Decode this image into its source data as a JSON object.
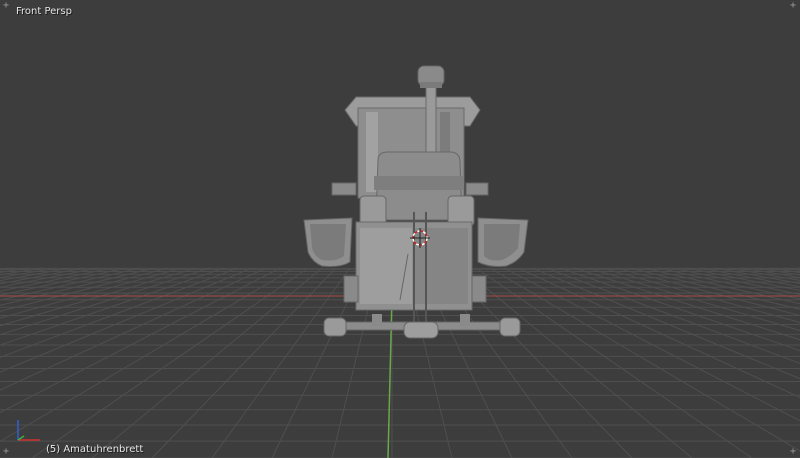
{
  "viewport": {
    "view_label": "Front Persp",
    "object_label": "(5) Amatuhrenbrett",
    "corner_widget_glyph": "+"
  },
  "colors": {
    "background": "#3d3d3d",
    "grid_line": "#4f4f4f",
    "x_axis": "#a84a4a",
    "y_axis": "#6aa84a",
    "model_base": "#8c8c8c",
    "model_light": "#a6a6a6",
    "model_dark": "#6e6e6e",
    "cursor_red": "#d02020"
  },
  "icons": {
    "axis_widget": "xyz-axes-icon",
    "corner_widget": "plus-icon",
    "cursor": "3d-cursor-icon"
  }
}
